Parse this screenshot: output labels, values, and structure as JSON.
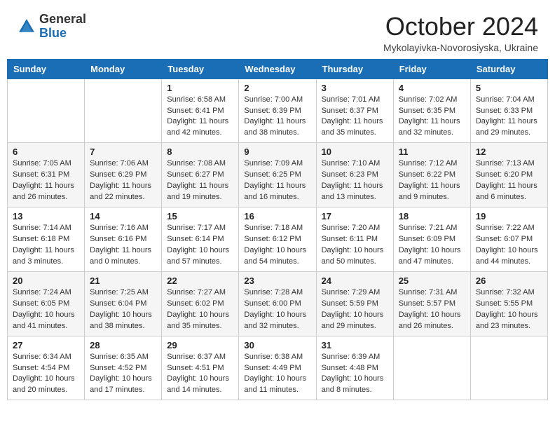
{
  "header": {
    "logo_general": "General",
    "logo_blue": "Blue",
    "month_title": "October 2024",
    "subtitle": "Mykolayivka-Novorosiyska, Ukraine"
  },
  "weekdays": [
    "Sunday",
    "Monday",
    "Tuesday",
    "Wednesday",
    "Thursday",
    "Friday",
    "Saturday"
  ],
  "weeks": [
    [
      {
        "day": "",
        "info": ""
      },
      {
        "day": "",
        "info": ""
      },
      {
        "day": "1",
        "info": "Sunrise: 6:58 AM\nSunset: 6:41 PM\nDaylight: 11 hours and 42 minutes."
      },
      {
        "day": "2",
        "info": "Sunrise: 7:00 AM\nSunset: 6:39 PM\nDaylight: 11 hours and 38 minutes."
      },
      {
        "day": "3",
        "info": "Sunrise: 7:01 AM\nSunset: 6:37 PM\nDaylight: 11 hours and 35 minutes."
      },
      {
        "day": "4",
        "info": "Sunrise: 7:02 AM\nSunset: 6:35 PM\nDaylight: 11 hours and 32 minutes."
      },
      {
        "day": "5",
        "info": "Sunrise: 7:04 AM\nSunset: 6:33 PM\nDaylight: 11 hours and 29 minutes."
      }
    ],
    [
      {
        "day": "6",
        "info": "Sunrise: 7:05 AM\nSunset: 6:31 PM\nDaylight: 11 hours and 26 minutes."
      },
      {
        "day": "7",
        "info": "Sunrise: 7:06 AM\nSunset: 6:29 PM\nDaylight: 11 hours and 22 minutes."
      },
      {
        "day": "8",
        "info": "Sunrise: 7:08 AM\nSunset: 6:27 PM\nDaylight: 11 hours and 19 minutes."
      },
      {
        "day": "9",
        "info": "Sunrise: 7:09 AM\nSunset: 6:25 PM\nDaylight: 11 hours and 16 minutes."
      },
      {
        "day": "10",
        "info": "Sunrise: 7:10 AM\nSunset: 6:23 PM\nDaylight: 11 hours and 13 minutes."
      },
      {
        "day": "11",
        "info": "Sunrise: 7:12 AM\nSunset: 6:22 PM\nDaylight: 11 hours and 9 minutes."
      },
      {
        "day": "12",
        "info": "Sunrise: 7:13 AM\nSunset: 6:20 PM\nDaylight: 11 hours and 6 minutes."
      }
    ],
    [
      {
        "day": "13",
        "info": "Sunrise: 7:14 AM\nSunset: 6:18 PM\nDaylight: 11 hours and 3 minutes."
      },
      {
        "day": "14",
        "info": "Sunrise: 7:16 AM\nSunset: 6:16 PM\nDaylight: 11 hours and 0 minutes."
      },
      {
        "day": "15",
        "info": "Sunrise: 7:17 AM\nSunset: 6:14 PM\nDaylight: 10 hours and 57 minutes."
      },
      {
        "day": "16",
        "info": "Sunrise: 7:18 AM\nSunset: 6:12 PM\nDaylight: 10 hours and 54 minutes."
      },
      {
        "day": "17",
        "info": "Sunrise: 7:20 AM\nSunset: 6:11 PM\nDaylight: 10 hours and 50 minutes."
      },
      {
        "day": "18",
        "info": "Sunrise: 7:21 AM\nSunset: 6:09 PM\nDaylight: 10 hours and 47 minutes."
      },
      {
        "day": "19",
        "info": "Sunrise: 7:22 AM\nSunset: 6:07 PM\nDaylight: 10 hours and 44 minutes."
      }
    ],
    [
      {
        "day": "20",
        "info": "Sunrise: 7:24 AM\nSunset: 6:05 PM\nDaylight: 10 hours and 41 minutes."
      },
      {
        "day": "21",
        "info": "Sunrise: 7:25 AM\nSunset: 6:04 PM\nDaylight: 10 hours and 38 minutes."
      },
      {
        "day": "22",
        "info": "Sunrise: 7:27 AM\nSunset: 6:02 PM\nDaylight: 10 hours and 35 minutes."
      },
      {
        "day": "23",
        "info": "Sunrise: 7:28 AM\nSunset: 6:00 PM\nDaylight: 10 hours and 32 minutes."
      },
      {
        "day": "24",
        "info": "Sunrise: 7:29 AM\nSunset: 5:59 PM\nDaylight: 10 hours and 29 minutes."
      },
      {
        "day": "25",
        "info": "Sunrise: 7:31 AM\nSunset: 5:57 PM\nDaylight: 10 hours and 26 minutes."
      },
      {
        "day": "26",
        "info": "Sunrise: 7:32 AM\nSunset: 5:55 PM\nDaylight: 10 hours and 23 minutes."
      }
    ],
    [
      {
        "day": "27",
        "info": "Sunrise: 6:34 AM\nSunset: 4:54 PM\nDaylight: 10 hours and 20 minutes."
      },
      {
        "day": "28",
        "info": "Sunrise: 6:35 AM\nSunset: 4:52 PM\nDaylight: 10 hours and 17 minutes."
      },
      {
        "day": "29",
        "info": "Sunrise: 6:37 AM\nSunset: 4:51 PM\nDaylight: 10 hours and 14 minutes."
      },
      {
        "day": "30",
        "info": "Sunrise: 6:38 AM\nSunset: 4:49 PM\nDaylight: 10 hours and 11 minutes."
      },
      {
        "day": "31",
        "info": "Sunrise: 6:39 AM\nSunset: 4:48 PM\nDaylight: 10 hours and 8 minutes."
      },
      {
        "day": "",
        "info": ""
      },
      {
        "day": "",
        "info": ""
      }
    ]
  ]
}
